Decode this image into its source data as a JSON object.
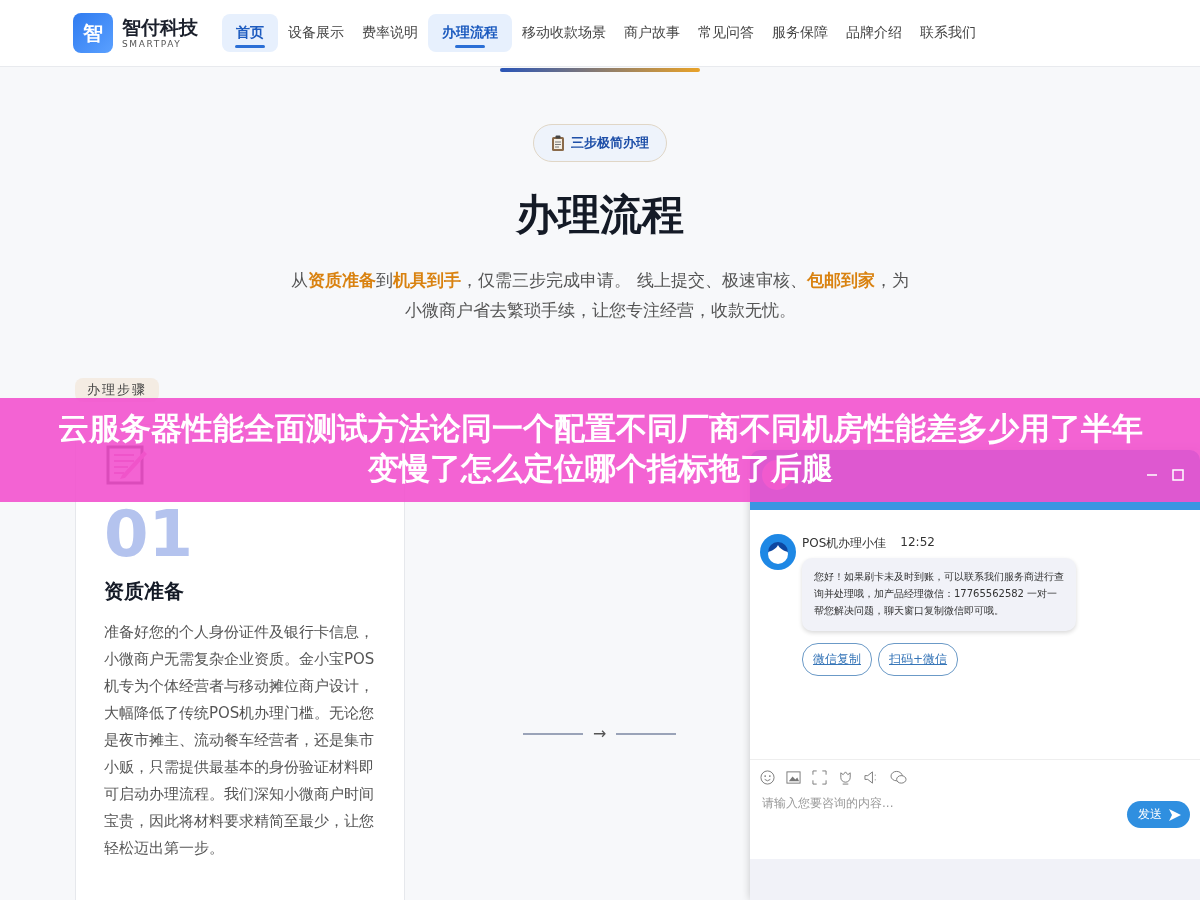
{
  "brand": {
    "logo_char": "智",
    "name": "智付科技",
    "tagline": "SMARTPAY"
  },
  "nav": [
    {
      "label": "首页",
      "selected": true
    },
    {
      "label": "设备展示",
      "selected": false
    },
    {
      "label": "费率说明",
      "selected": false
    },
    {
      "label": "办理流程",
      "selected": true
    },
    {
      "label": "移动收款场景",
      "selected": false
    },
    {
      "label": "商户故事",
      "selected": false
    },
    {
      "label": "常见问答",
      "selected": false
    },
    {
      "label": "服务保障",
      "selected": false
    },
    {
      "label": "品牌介绍",
      "selected": false
    },
    {
      "label": "联系我们",
      "selected": false
    }
  ],
  "hero": {
    "badge": "三步极简办理",
    "title": "办理流程",
    "intro": "从**资质准备**到**机具到手**，仅需三步完成申请。 线上提交、极速审核、**包邮到家**，为小微商户省去繁琐手续，让您专注经营，收款无忧。"
  },
  "steps": {
    "tag": "办理步骤",
    "cards": [
      {
        "number": "01",
        "title": "资质准备",
        "text": "准备好您的个人身份证件及银行卡信息，小微商户无需复杂企业资质。金小宝POS机专为个体经营者与移动摊位商户设计，大幅降低了传统POS机办理门槛。无论您是夜市摊主、流动餐车经营者，还是集市小贩，只需提供最基本的身份验证材料即可启动办理流程。我们深知小微商户时间宝贵，因此将材料要求精简至最少，让您轻松迈出第一步。"
      }
    ],
    "connector": "→"
  },
  "chat": {
    "agent": "POS机办理小佳",
    "time": "12:52",
    "message": "您好！如果刷卡未及时到账，可以联系我们服务商进行查询并处理哦，加产品经理微信：17765562582 一对一帮您解决问题，聊天窗口复制微信即可哦。",
    "actions": [
      "微信复制",
      "扫码+微信"
    ],
    "placeholder": "请输入您要咨询的内容...",
    "send": "发送"
  },
  "overlay_banner": "云服务器性能全面测试方法论同一个配置不同厂商不同机房性能差多少用了半年变慢了怎么定位哪个指标拖了后腿"
}
